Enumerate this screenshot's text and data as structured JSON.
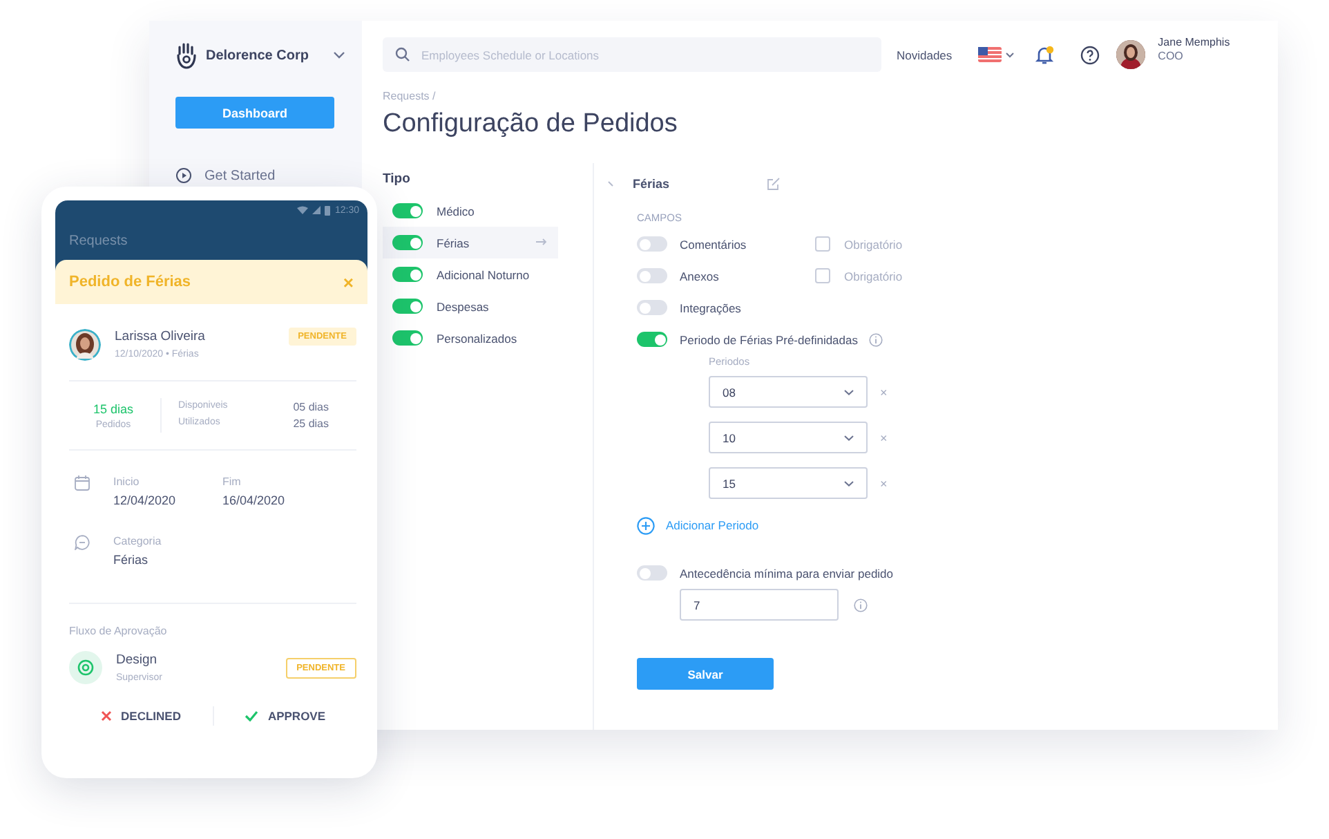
{
  "sidebar": {
    "company": "Delorence Corp",
    "dashboard_button": "Dashboard",
    "items": [
      {
        "label": "Get Started"
      }
    ]
  },
  "topbar": {
    "search": {
      "placeholder": "Employees Schedule or Locations"
    },
    "news": "Novidades",
    "has_unread": true,
    "user": {
      "name": "Jane Memphis",
      "role": "COO"
    }
  },
  "breadcrumb": "Requests /",
  "title": "Configuração de Pedidos",
  "types": {
    "heading": "Tipo",
    "items": [
      {
        "label": "Médico",
        "on": true,
        "selected": false
      },
      {
        "label": "Férias",
        "on": true,
        "selected": true
      },
      {
        "label": "Adicional Noturno",
        "on": true,
        "selected": false
      },
      {
        "label": "Despesas",
        "on": true,
        "selected": false
      },
      {
        "label": "Personalizados",
        "on": true,
        "selected": false
      }
    ]
  },
  "detail": {
    "title": "Férias",
    "section": "CAMPOS",
    "fields": [
      {
        "label": "Comentários",
        "on": false,
        "info": false,
        "required": {
          "label": "Obrigatório",
          "checked": false
        }
      },
      {
        "label": "Anexos",
        "on": false,
        "info": false,
        "required": {
          "label": "Obrigatório",
          "checked": false
        }
      },
      {
        "label": "Integrações",
        "on": false,
        "info": false
      },
      {
        "label": "Periodo de Férias Pré-definidadas",
        "on": true,
        "info": true
      }
    ],
    "periods": {
      "label": "Periodos",
      "items": [
        {
          "value": "08",
          "remove": "×"
        },
        {
          "value": "10",
          "remove": "×"
        },
        {
          "value": "15",
          "remove": "×"
        }
      ]
    },
    "add_period": "Adicionar Periodo",
    "advance": {
      "label": "Antecedência mínima para enviar pedido",
      "on": false,
      "value": "7"
    },
    "save_button": "Salvar"
  },
  "phone": {
    "status_time": "12:30",
    "header": "Requests",
    "banner": {
      "title": "Pedido de Férias",
      "close": "×"
    },
    "employee": {
      "name": "Larissa Oliveira",
      "meta": "12/10/2020 • Férias",
      "status": "PENDENTE"
    },
    "stats": {
      "requested": {
        "value": "15 dias",
        "label": "Pedidos"
      },
      "rows": [
        {
          "label": "Disponiveis",
          "value": "05 dias"
        },
        {
          "label": "Utilizados",
          "value": "25 dias"
        }
      ]
    },
    "dates": [
      {
        "label": "Inicio",
        "value": "12/04/2020"
      },
      {
        "label": "Fim",
        "value": "16/04/2020"
      }
    ],
    "category": {
      "label": "Categoria",
      "value": "Férias"
    },
    "approval": {
      "heading": "Fluxo de Aprovação",
      "steps": [
        {
          "name": "Design",
          "role": "Supervisor",
          "status": "PENDENTE"
        }
      ]
    },
    "actions": [
      {
        "kind": "decline",
        "label": "DECLINED"
      },
      {
        "kind": "approve",
        "label": "APPROVE"
      }
    ]
  }
}
